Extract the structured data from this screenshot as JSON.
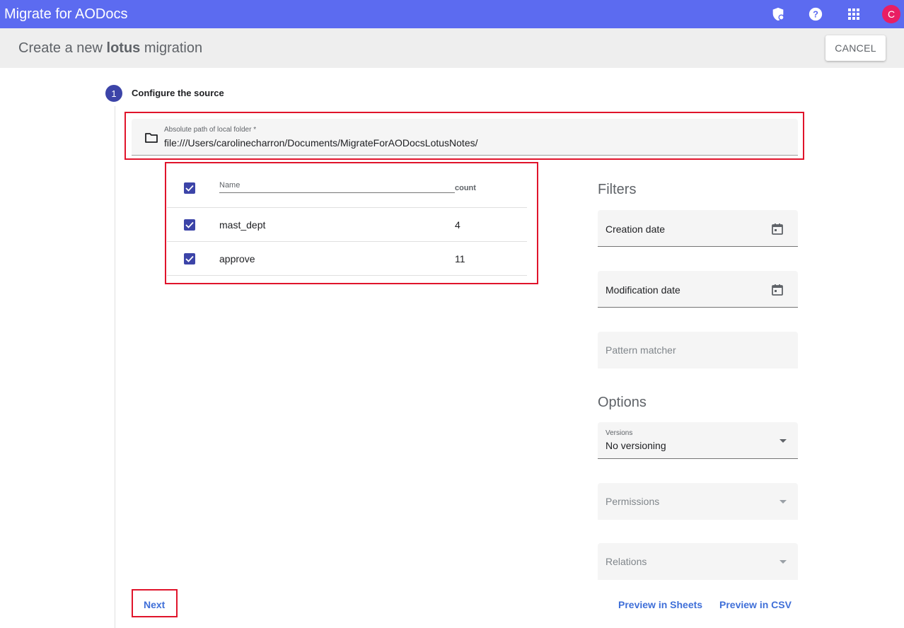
{
  "appbar": {
    "title": "Migrate for AODocs",
    "icons": [
      "admin-shield-icon",
      "help-icon",
      "apps-grid-icon"
    ],
    "avatar_letter": "C",
    "colors": {
      "appbar": "#5c6bf0",
      "avatar": "#e91e63"
    }
  },
  "header": {
    "title_prefix": "Create a new ",
    "title_bold": "lotus",
    "title_suffix": " migration",
    "cancel_label": "CANCEL"
  },
  "step": {
    "number": "1",
    "title": "Configure the source"
  },
  "source": {
    "path_label": "Absolute path of local folder *",
    "path_value": "file:///Users/carolinecharron/Documents/MigrateForAODocsLotusNotes/"
  },
  "table": {
    "columns": {
      "name": "Name",
      "count": "count"
    },
    "rows": [
      {
        "name": "mast_dept",
        "count": "4",
        "checked": true
      },
      {
        "name": "approve",
        "count": "11",
        "checked": true
      }
    ]
  },
  "filters": {
    "title": "Filters",
    "creation_date": "Creation date",
    "modification_date": "Modification date",
    "pattern_matcher": "Pattern matcher"
  },
  "options": {
    "title": "Options",
    "versions_label": "Versions",
    "versions_value": "No versioning",
    "permissions": "Permissions",
    "relations": "Relations"
  },
  "footer": {
    "next_label": "Next",
    "preview_sheets": "Preview in Sheets",
    "preview_csv": "Preview in CSV"
  },
  "accent_colors": {
    "primary": "#3c44a8",
    "link": "#3f6fd8",
    "highlight": "#e0142b"
  }
}
